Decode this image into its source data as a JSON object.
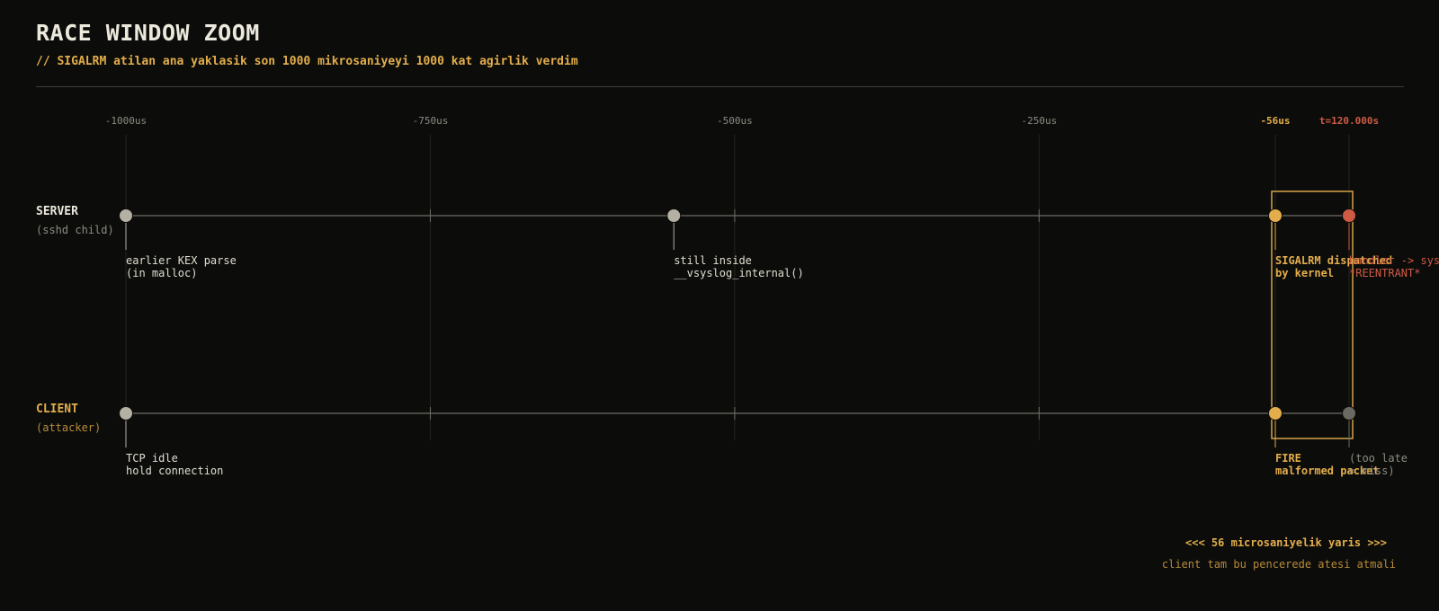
{
  "header": {
    "title": "RACE WINDOW ZOOM",
    "subtitle": "// SIGALRM atilan ana yaklasik son 1000 mikrosaniyeyi 1000 kat agirlik verdim"
  },
  "colors": {
    "accent": "#e3ad4c",
    "danger": "#cf5a44",
    "muted": "#8c8a80",
    "node": "#b4b0a4",
    "inactive": "#6b6a62",
    "line": "#6f6d65",
    "grid": "#24241f"
  },
  "axis": {
    "unit": "us",
    "range": [
      -1000,
      0
    ],
    "ticks": [
      {
        "value": -1000,
        "label": "-1000us",
        "style": "normal"
      },
      {
        "value": -750,
        "label": "-750us",
        "style": "normal"
      },
      {
        "value": -500,
        "label": "-500us",
        "style": "normal"
      },
      {
        "value": -250,
        "label": "-250us",
        "style": "normal"
      },
      {
        "value": -56,
        "label": "-56us",
        "style": "accent"
      },
      {
        "value": 0,
        "label": "t=120.000s",
        "style": "danger"
      }
    ]
  },
  "window": {
    "from": -56,
    "to": 0
  },
  "lanes": [
    {
      "id": "server",
      "name": "SERVER",
      "sub": "(sshd child)",
      "name_color": "#ece8dc",
      "sub_color": "#8c8a80",
      "events": [
        {
          "t": -1000,
          "status": "normal",
          "lines": [
            "earlier KEX parse",
            "(in malloc)"
          ]
        },
        {
          "t": -550,
          "status": "normal",
          "lines": [
            "still inside",
            "__vsyslog_internal()"
          ]
        },
        {
          "t": -56,
          "status": "accent",
          "lines": [
            "SIGALRM dispatched",
            "by kernel"
          ]
        },
        {
          "t": 0,
          "status": "danger",
          "lines": [
            "handler -> syslog()",
            "*REENTRANT*"
          ]
        }
      ]
    },
    {
      "id": "client",
      "name": "CLIENT",
      "sub": "(attacker)",
      "name_color": "#e3ad4c",
      "sub_color": "#b78a3a",
      "events": [
        {
          "t": -1000,
          "status": "normal",
          "lines": [
            "TCP idle",
            "hold connection"
          ]
        },
        {
          "t": -56,
          "status": "accent",
          "lines": [
            "FIRE",
            "malformed packet"
          ]
        },
        {
          "t": 0,
          "status": "inactive",
          "lines": [
            "(too late",
            " = miss)"
          ]
        }
      ]
    }
  ],
  "race_note": {
    "title": "<<<  56 microsaniyelik yaris  >>>",
    "sub": "client tam bu pencerede atesi atmali"
  }
}
